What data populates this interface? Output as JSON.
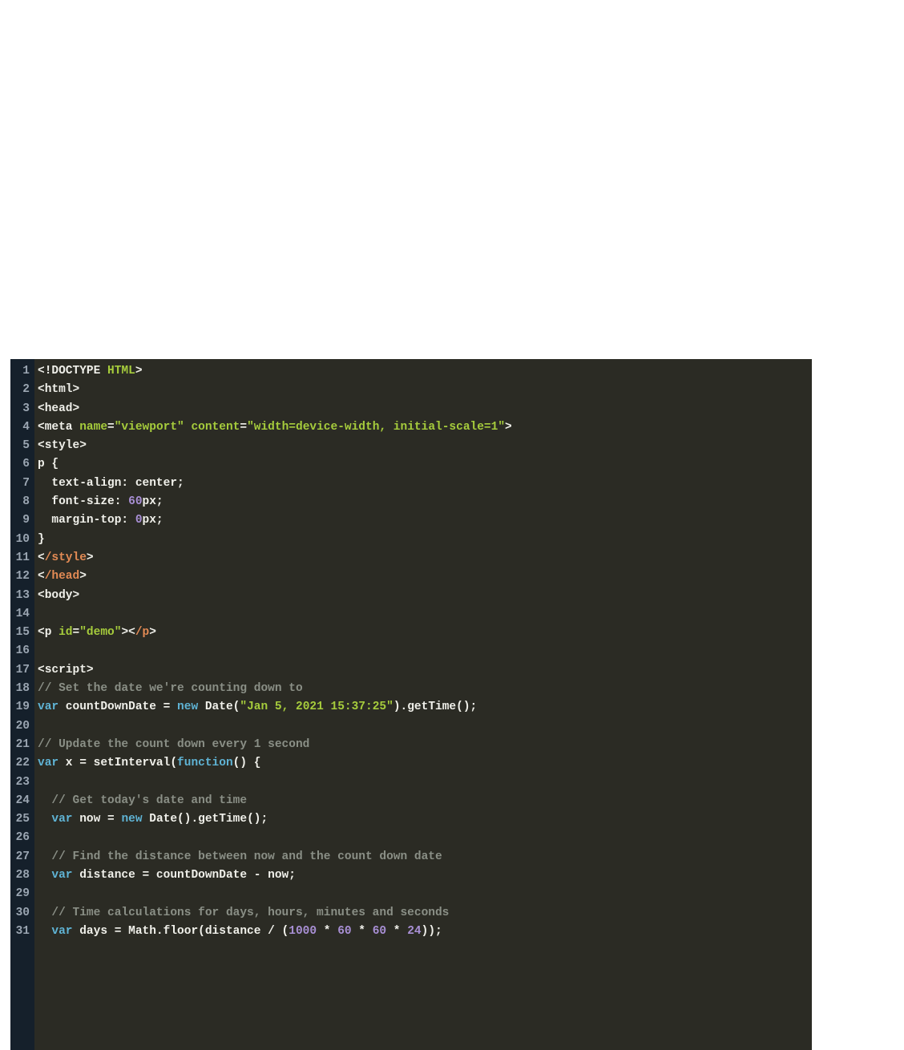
{
  "editor": {
    "lineNumbers": [
      "1",
      "2",
      "3",
      "4",
      "5",
      "6",
      "7",
      "8",
      "9",
      "10",
      "11",
      "12",
      "13",
      "14",
      "15",
      "16",
      "17",
      "18",
      "19",
      "20",
      "21",
      "22",
      "23",
      "24",
      "25",
      "26",
      "27",
      "28",
      "29",
      "30",
      "31"
    ],
    "lines": [
      [
        {
          "cls": "tok-punct",
          "t": "<!"
        },
        {
          "cls": "tok-tag",
          "t": "DOCTYPE"
        },
        {
          "cls": "tok-punct",
          "t": " "
        },
        {
          "cls": "tok-attr",
          "t": "HTML"
        },
        {
          "cls": "tok-punct",
          "t": ">"
        }
      ],
      [
        {
          "cls": "tok-punct",
          "t": "<"
        },
        {
          "cls": "tok-tag",
          "t": "html"
        },
        {
          "cls": "tok-punct",
          "t": ">"
        }
      ],
      [
        {
          "cls": "tok-punct",
          "t": "<"
        },
        {
          "cls": "tok-tag",
          "t": "head"
        },
        {
          "cls": "tok-punct",
          "t": ">"
        }
      ],
      [
        {
          "cls": "tok-punct",
          "t": "<"
        },
        {
          "cls": "tok-tag",
          "t": "meta"
        },
        {
          "cls": "tok-punct",
          "t": " "
        },
        {
          "cls": "tok-attr",
          "t": "name"
        },
        {
          "cls": "tok-punct",
          "t": "="
        },
        {
          "cls": "tok-string",
          "t": "\"viewport\""
        },
        {
          "cls": "tok-punct",
          "t": " "
        },
        {
          "cls": "tok-attr",
          "t": "content"
        },
        {
          "cls": "tok-punct",
          "t": "="
        },
        {
          "cls": "tok-string",
          "t": "\"width=device-width, initial-scale=1\""
        },
        {
          "cls": "tok-punct",
          "t": ">"
        }
      ],
      [
        {
          "cls": "tok-punct",
          "t": "<"
        },
        {
          "cls": "tok-tag",
          "t": "style"
        },
        {
          "cls": "tok-punct",
          "t": ">"
        }
      ],
      [
        {
          "cls": "tok-func",
          "t": "p {"
        }
      ],
      [
        {
          "cls": "tok-func",
          "t": "  text-align: center;"
        }
      ],
      [
        {
          "cls": "tok-func",
          "t": "  font-size: "
        },
        {
          "cls": "tok-number",
          "t": "60"
        },
        {
          "cls": "tok-func",
          "t": "px;"
        }
      ],
      [
        {
          "cls": "tok-func",
          "t": "  margin-top: "
        },
        {
          "cls": "tok-number",
          "t": "0"
        },
        {
          "cls": "tok-func",
          "t": "px;"
        }
      ],
      [
        {
          "cls": "tok-func",
          "t": "}"
        }
      ],
      [
        {
          "cls": "tok-punct",
          "t": "<"
        },
        {
          "cls": "tok-close",
          "t": "/style"
        },
        {
          "cls": "tok-punct",
          "t": ">"
        }
      ],
      [
        {
          "cls": "tok-punct",
          "t": "<"
        },
        {
          "cls": "tok-close",
          "t": "/head"
        },
        {
          "cls": "tok-punct",
          "t": ">"
        }
      ],
      [
        {
          "cls": "tok-punct",
          "t": "<"
        },
        {
          "cls": "tok-tag",
          "t": "body"
        },
        {
          "cls": "tok-punct",
          "t": ">"
        }
      ],
      [
        {
          "cls": "tok-func",
          "t": ""
        }
      ],
      [
        {
          "cls": "tok-punct",
          "t": "<"
        },
        {
          "cls": "tok-tag",
          "t": "p"
        },
        {
          "cls": "tok-punct",
          "t": " "
        },
        {
          "cls": "tok-attr",
          "t": "id"
        },
        {
          "cls": "tok-punct",
          "t": "="
        },
        {
          "cls": "tok-string",
          "t": "\"demo\""
        },
        {
          "cls": "tok-punct",
          "t": "><"
        },
        {
          "cls": "tok-close",
          "t": "/p"
        },
        {
          "cls": "tok-punct",
          "t": ">"
        }
      ],
      [
        {
          "cls": "tok-func",
          "t": ""
        }
      ],
      [
        {
          "cls": "tok-punct",
          "t": "<"
        },
        {
          "cls": "tok-tag",
          "t": "script"
        },
        {
          "cls": "tok-punct",
          "t": ">"
        }
      ],
      [
        {
          "cls": "tok-comment",
          "t": "// Set the date we're counting down to"
        }
      ],
      [
        {
          "cls": "tok-keyword",
          "t": "var"
        },
        {
          "cls": "tok-func",
          "t": " countDownDate = "
        },
        {
          "cls": "tok-keyword",
          "t": "new"
        },
        {
          "cls": "tok-func",
          "t": " Date("
        },
        {
          "cls": "tok-string",
          "t": "\"Jan 5, 2021 15:37:25\""
        },
        {
          "cls": "tok-func",
          "t": ").getTime();"
        }
      ],
      [
        {
          "cls": "tok-func",
          "t": ""
        }
      ],
      [
        {
          "cls": "tok-comment",
          "t": "// Update the count down every 1 second"
        }
      ],
      [
        {
          "cls": "tok-keyword",
          "t": "var"
        },
        {
          "cls": "tok-func",
          "t": " x = setInterval("
        },
        {
          "cls": "tok-keyword",
          "t": "function"
        },
        {
          "cls": "tok-func",
          "t": "() {"
        }
      ],
      [
        {
          "cls": "tok-func",
          "t": ""
        }
      ],
      [
        {
          "cls": "tok-comment",
          "t": "  // Get today's date and time"
        }
      ],
      [
        {
          "cls": "tok-func",
          "t": "  "
        },
        {
          "cls": "tok-keyword",
          "t": "var"
        },
        {
          "cls": "tok-func",
          "t": " now = "
        },
        {
          "cls": "tok-keyword",
          "t": "new"
        },
        {
          "cls": "tok-func",
          "t": " Date().getTime();"
        }
      ],
      [
        {
          "cls": "tok-func",
          "t": ""
        }
      ],
      [
        {
          "cls": "tok-comment",
          "t": "  // Find the distance between now and the count down date"
        }
      ],
      [
        {
          "cls": "tok-func",
          "t": "  "
        },
        {
          "cls": "tok-keyword",
          "t": "var"
        },
        {
          "cls": "tok-func",
          "t": " distance = countDownDate - now;"
        }
      ],
      [
        {
          "cls": "tok-func",
          "t": ""
        }
      ],
      [
        {
          "cls": "tok-comment",
          "t": "  // Time calculations for days, hours, minutes and seconds"
        }
      ],
      [
        {
          "cls": "tok-func",
          "t": "  "
        },
        {
          "cls": "tok-keyword",
          "t": "var"
        },
        {
          "cls": "tok-func",
          "t": " days = Math.floor(distance / ("
        },
        {
          "cls": "tok-number",
          "t": "1000"
        },
        {
          "cls": "tok-func",
          "t": " * "
        },
        {
          "cls": "tok-number",
          "t": "60"
        },
        {
          "cls": "tok-func",
          "t": " * "
        },
        {
          "cls": "tok-number",
          "t": "60"
        },
        {
          "cls": "tok-func",
          "t": " * "
        },
        {
          "cls": "tok-number",
          "t": "24"
        },
        {
          "cls": "tok-func",
          "t": "));"
        }
      ]
    ]
  }
}
